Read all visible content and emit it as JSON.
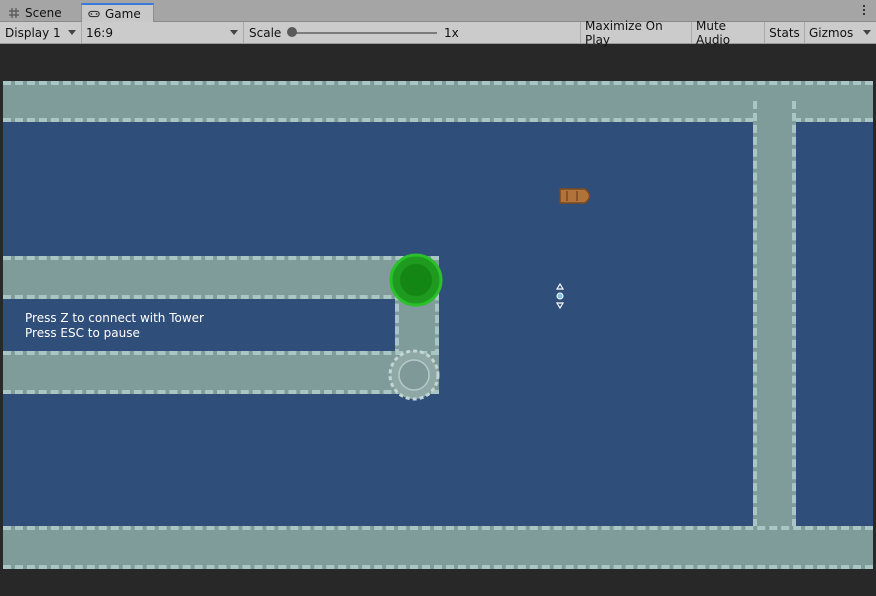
{
  "tabs": [
    {
      "label": "Scene",
      "icon": "grid-icon",
      "active": false
    },
    {
      "label": "Game",
      "icon": "gamepad-icon",
      "active": true
    }
  ],
  "toolbar": {
    "display": "Display 1",
    "aspect": "16:9",
    "scale_label": "Scale",
    "scale_value": "1x",
    "maximize_label": "Maximize On Play",
    "mute_label": "Mute Audio",
    "stats_label": "Stats",
    "gizmos_label": "Gizmos"
  },
  "game": {
    "hint_line1": "Press Z to connect with Tower",
    "hint_line2": "Press ESC to pause",
    "colors": {
      "water": "#2f4e7a",
      "wall": "#7f9c9b",
      "wall_edge": "#a9c6c4",
      "tower_active": "#2bc02b",
      "tower_inactive": "#8fa8a6",
      "boat": "#b2733a"
    }
  }
}
